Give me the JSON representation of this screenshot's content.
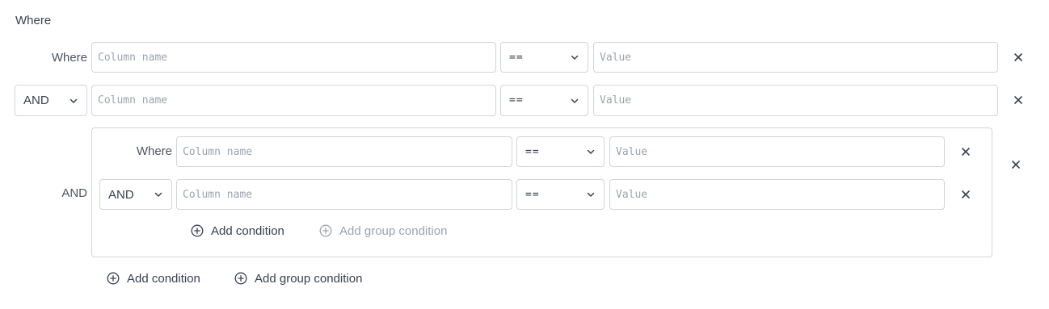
{
  "section_title": "Where",
  "placeholders": {
    "column": "Column name",
    "value": "Value"
  },
  "rows": [
    {
      "connector": "Where",
      "column": "",
      "operator": "==",
      "value": ""
    },
    {
      "connector": "AND",
      "column": "",
      "operator": "==",
      "value": ""
    }
  ],
  "group": {
    "connector": "AND",
    "rows": [
      {
        "connector": "Where",
        "column": "",
        "operator": "==",
        "value": ""
      },
      {
        "connector": "AND",
        "column": "",
        "operator": "==",
        "value": ""
      }
    ],
    "add_condition_label": "Add condition",
    "add_group_condition_label": "Add group condition"
  },
  "add_condition_label": "Add condition",
  "add_group_condition_label": "Add group condition",
  "icons": {
    "remove": "close-icon",
    "dropdown": "chevron-down-icon",
    "add": "plus-circle-icon"
  }
}
